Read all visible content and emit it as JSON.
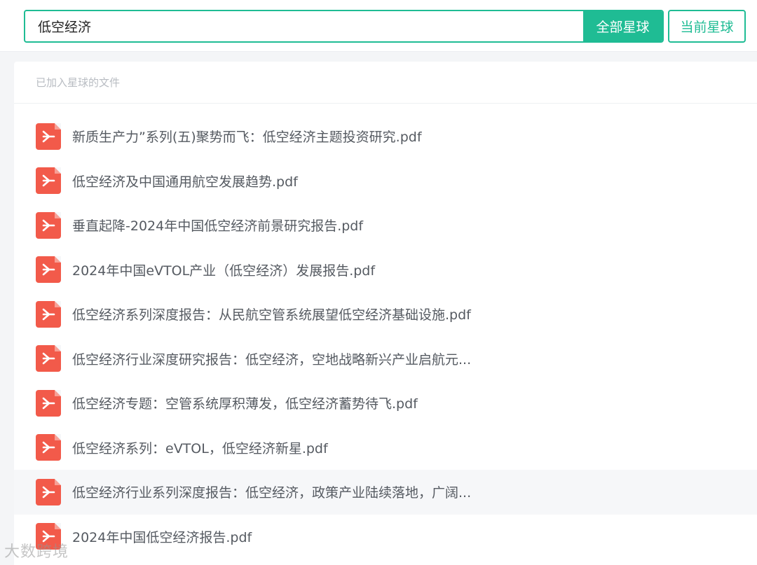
{
  "search": {
    "value": "低空经济",
    "all_button": "全部星球",
    "current_button": "当前星球"
  },
  "section": {
    "header": "已加入星球的文件"
  },
  "files": [
    {
      "name": "新质生产力”系列(五)聚势而飞：低空经济主题投资研究.pdf",
      "icon": "pdf-icon"
    },
    {
      "name": "低空经济及中国通用航空发展趋势.pdf",
      "icon": "pdf-icon"
    },
    {
      "name": "垂直起降-2024年中国低空经济前景研究报告.pdf",
      "icon": "pdf-icon"
    },
    {
      "name": "2024年中国eVTOL产业（低空经济）发展报告.pdf",
      "icon": "pdf-icon"
    },
    {
      "name": "低空经济系列深度报告：从民航空管系统展望低空经济基础设施.pdf",
      "icon": "pdf-icon"
    },
    {
      "name": "低空经济行业深度研究报告：低空经济，空地战略新兴产业启航元...",
      "icon": "pdf-icon"
    },
    {
      "name": "低空经济专题：空管系统厚积薄发，低空经济蓄势待飞.pdf",
      "icon": "pdf-icon"
    },
    {
      "name": "低空经济系列：eVTOL，低空经济新星.pdf",
      "icon": "pdf-icon"
    },
    {
      "name": "低空经济行业系列深度报告：低空经济，政策产业陆续落地，广阔...",
      "icon": "pdf-icon"
    },
    {
      "name": "2024年中国低空经济报告.pdf",
      "icon": "pdf-icon"
    }
  ],
  "watermark": "大数跨境",
  "colors": {
    "accent": "#1fbc94",
    "pdf": "#f25a4a"
  }
}
